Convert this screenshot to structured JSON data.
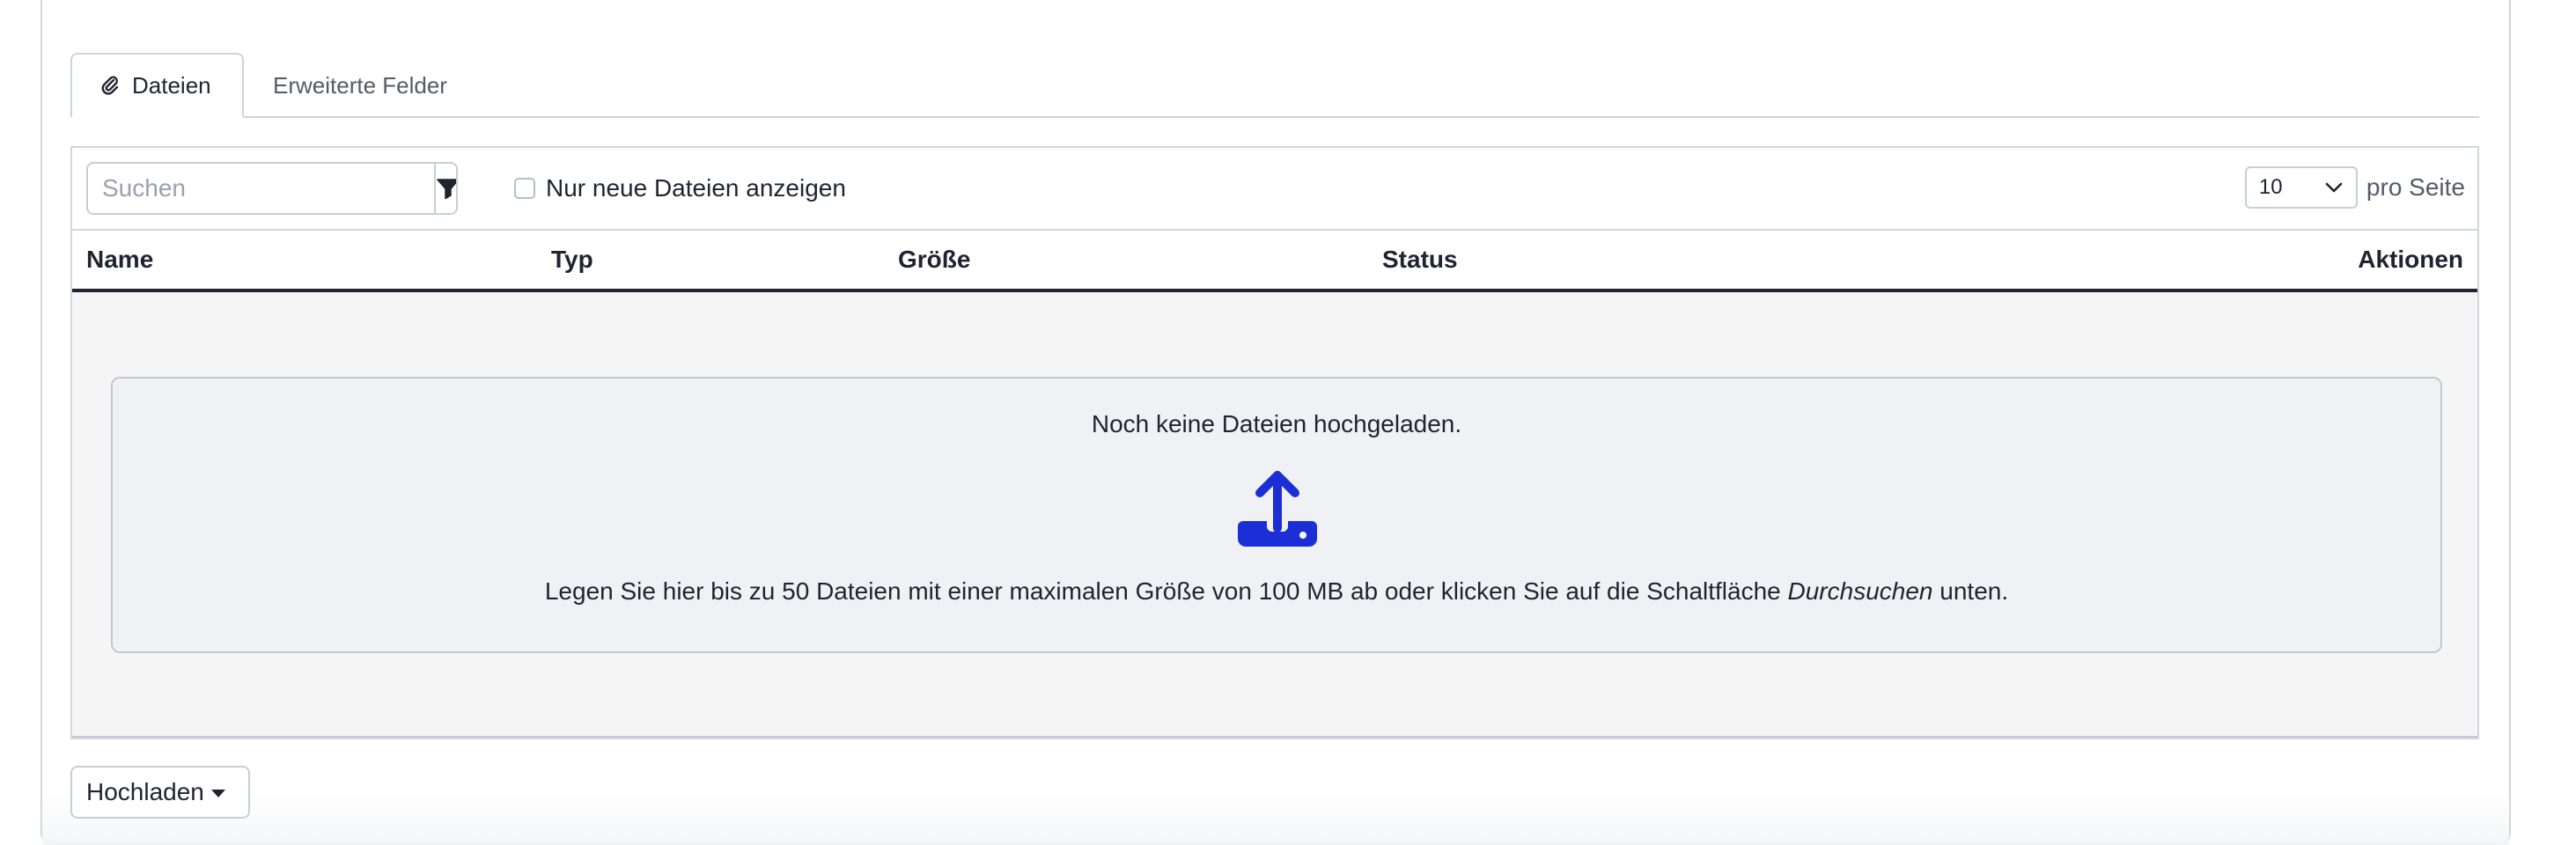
{
  "tabs": {
    "files": "Dateien",
    "extended_fields": "Erweiterte Felder"
  },
  "toolbar": {
    "search_placeholder": "Suchen",
    "new_files_only": "Nur neue Dateien anzeigen",
    "page_size_value": "10",
    "per_page_label": "pro Seite"
  },
  "table": {
    "columns": {
      "name": "Name",
      "type": "Typ",
      "size": "Größe",
      "status": "Status",
      "actions": "Aktionen"
    }
  },
  "dropzone": {
    "title": "Noch keine Dateien hochgeladen.",
    "hint_before": "Legen Sie hier bis zu 50 Dateien mit einer maximalen Größe von 100 MB ab oder klicken Sie auf die Schaltfläche ",
    "hint_emphasis": "Durchsuchen",
    "hint_after": " unten.",
    "icon": "upload-icon",
    "icon_color": "#1c2fd6"
  },
  "upload_button": {
    "label": "Hochladen"
  },
  "icons": {
    "tab_files": "paperclip-icon",
    "filter": "filter-icon",
    "page_size": "chevron-down-icon",
    "upload_menu": "caret-down-icon"
  }
}
